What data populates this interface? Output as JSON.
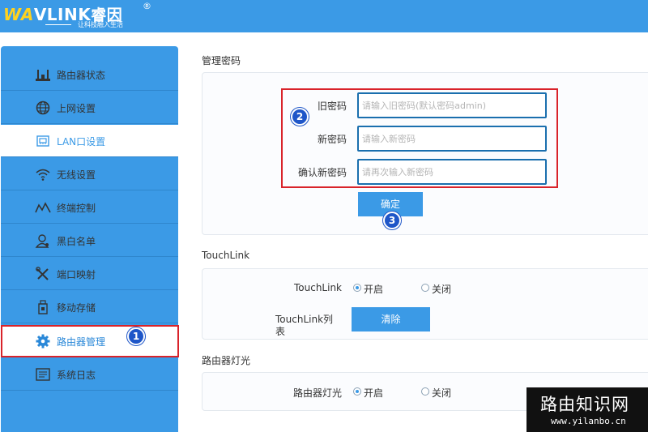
{
  "brand": {
    "logo_prefix": "WA",
    "logo_word": "VLINK",
    "logo_cn": "睿因",
    "registered_mark": "®",
    "slogan": "让科技融入生活"
  },
  "sidebar": {
    "items": [
      {
        "label": "路由器状态",
        "icon": "router-status-icon"
      },
      {
        "label": "上网设置",
        "icon": "globe-icon"
      },
      {
        "label": "LAN口设置",
        "icon": "lan-port-icon"
      },
      {
        "label": "无线设置",
        "icon": "wifi-icon"
      },
      {
        "label": "终端控制",
        "icon": "terminal-control-icon"
      },
      {
        "label": "黑白名单",
        "icon": "user-list-icon"
      },
      {
        "label": "端口映射",
        "icon": "tools-icon"
      },
      {
        "label": "移动存储",
        "icon": "usb-storage-icon"
      },
      {
        "label": "路由器管理",
        "icon": "gear-icon"
      },
      {
        "label": "系统日志",
        "icon": "log-icon"
      }
    ],
    "active_index": 2,
    "highlighted_index": 8
  },
  "password_section": {
    "title": "管理密码",
    "old_label": "旧密码",
    "old_placeholder": "请输入旧密码(默认密码admin)",
    "new_label": "新密码",
    "new_placeholder": "请输入新密码",
    "confirm_label": "确认新密码",
    "confirm_placeholder": "请再次输入新密码",
    "submit_label": "确定"
  },
  "touchlink_section": {
    "title": "TouchLink",
    "toggle_label": "TouchLink",
    "on_label": "开启",
    "off_label": "关闭",
    "toggle_value": "on",
    "list_label": "TouchLink列表",
    "clear_label": "清除"
  },
  "light_section": {
    "title": "路由器灯光",
    "toggle_label": "路由器灯光",
    "on_label": "开启",
    "off_label": "关闭",
    "toggle_value": "on"
  },
  "annotations": {
    "marker1": "1",
    "marker2": "2",
    "marker3": "3"
  },
  "watermark": {
    "title": "路由知识网",
    "url": "www.yilanbo.cn"
  },
  "colors": {
    "accent": "#3b9ae6",
    "highlight_border": "#d9232a",
    "marker": "#1e56c8"
  }
}
